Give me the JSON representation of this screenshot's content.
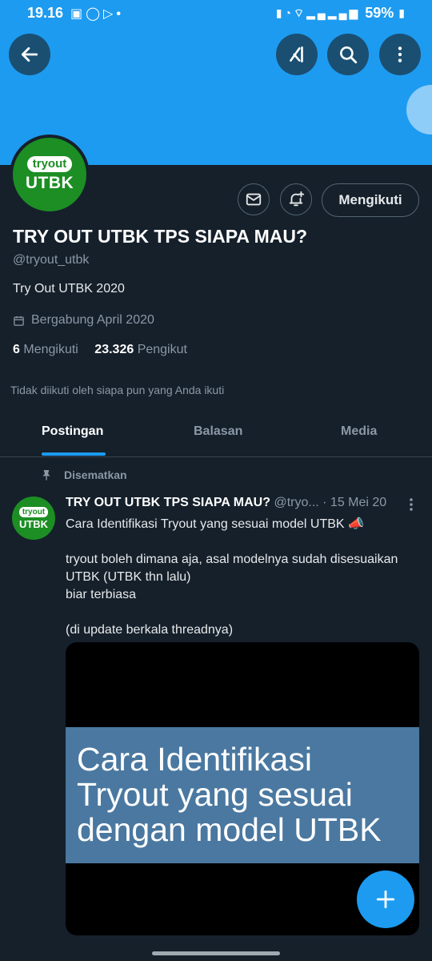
{
  "status_bar": {
    "time": "19.16",
    "battery": "59%",
    "left_icons": [
      "gallery-icon",
      "whatsapp-icon",
      "play-store-icon",
      "dot-icon"
    ],
    "right_icons": [
      "battery-saver-icon",
      "alarm-icon",
      "wifi-icon",
      "signal-icon",
      "signal-icon",
      "battery-icon"
    ]
  },
  "header": {
    "back_icon": "arrow-left-icon",
    "grok_icon": "grok-icon",
    "search_icon": "search-icon",
    "more_icon": "more-vertical-icon",
    "banner_color": "#1d9bf0"
  },
  "profile": {
    "avatar_top": "tryout",
    "avatar_bottom": "UTBK",
    "message_icon": "mail-icon",
    "notify_icon": "bell-plus-icon",
    "follow_label": "Mengikuti",
    "name": "TRY OUT UTBK TPS SIAPA MAU?",
    "handle": "@tryout_utbk",
    "bio": "Try Out UTBK 2020",
    "joined": "Bergabung April 2020",
    "following_count": "6",
    "following_label": "Mengikuti",
    "followers_count": "23.326",
    "followers_label": "Pengikut",
    "not_followed": "Tidak diikuti oleh siapa pun yang Anda ikuti"
  },
  "tabs": [
    {
      "label": "Postingan",
      "active": true
    },
    {
      "label": "Balasan",
      "active": false
    },
    {
      "label": "Media",
      "active": false
    }
  ],
  "post": {
    "pinned_label": "Disematkan",
    "author": "TRY OUT UTBK TPS SIAPA MAU?",
    "handle": "@tryo...",
    "date": "· 15 Mei 20",
    "avatar_top": "tryout",
    "avatar_bottom": "UTBK",
    "line1": "Cara Identifikasi Tryout yang sesuai model UTBK 📣",
    "line2": "tryout boleh dimana aja, asal modelnya sudah disesuaikan",
    "line3": "UTBK (UTBK thn lalu)",
    "line4": "biar terbiasa",
    "line5": "(di update berkala threadnya)",
    "media_line1": "Cara Identifikasi",
    "media_line2": "Tryout yang sesuai",
    "media_line3": "dengan model UTBK"
  },
  "fab": {
    "icon": "plus-icon",
    "color": "#1d9bf0"
  }
}
